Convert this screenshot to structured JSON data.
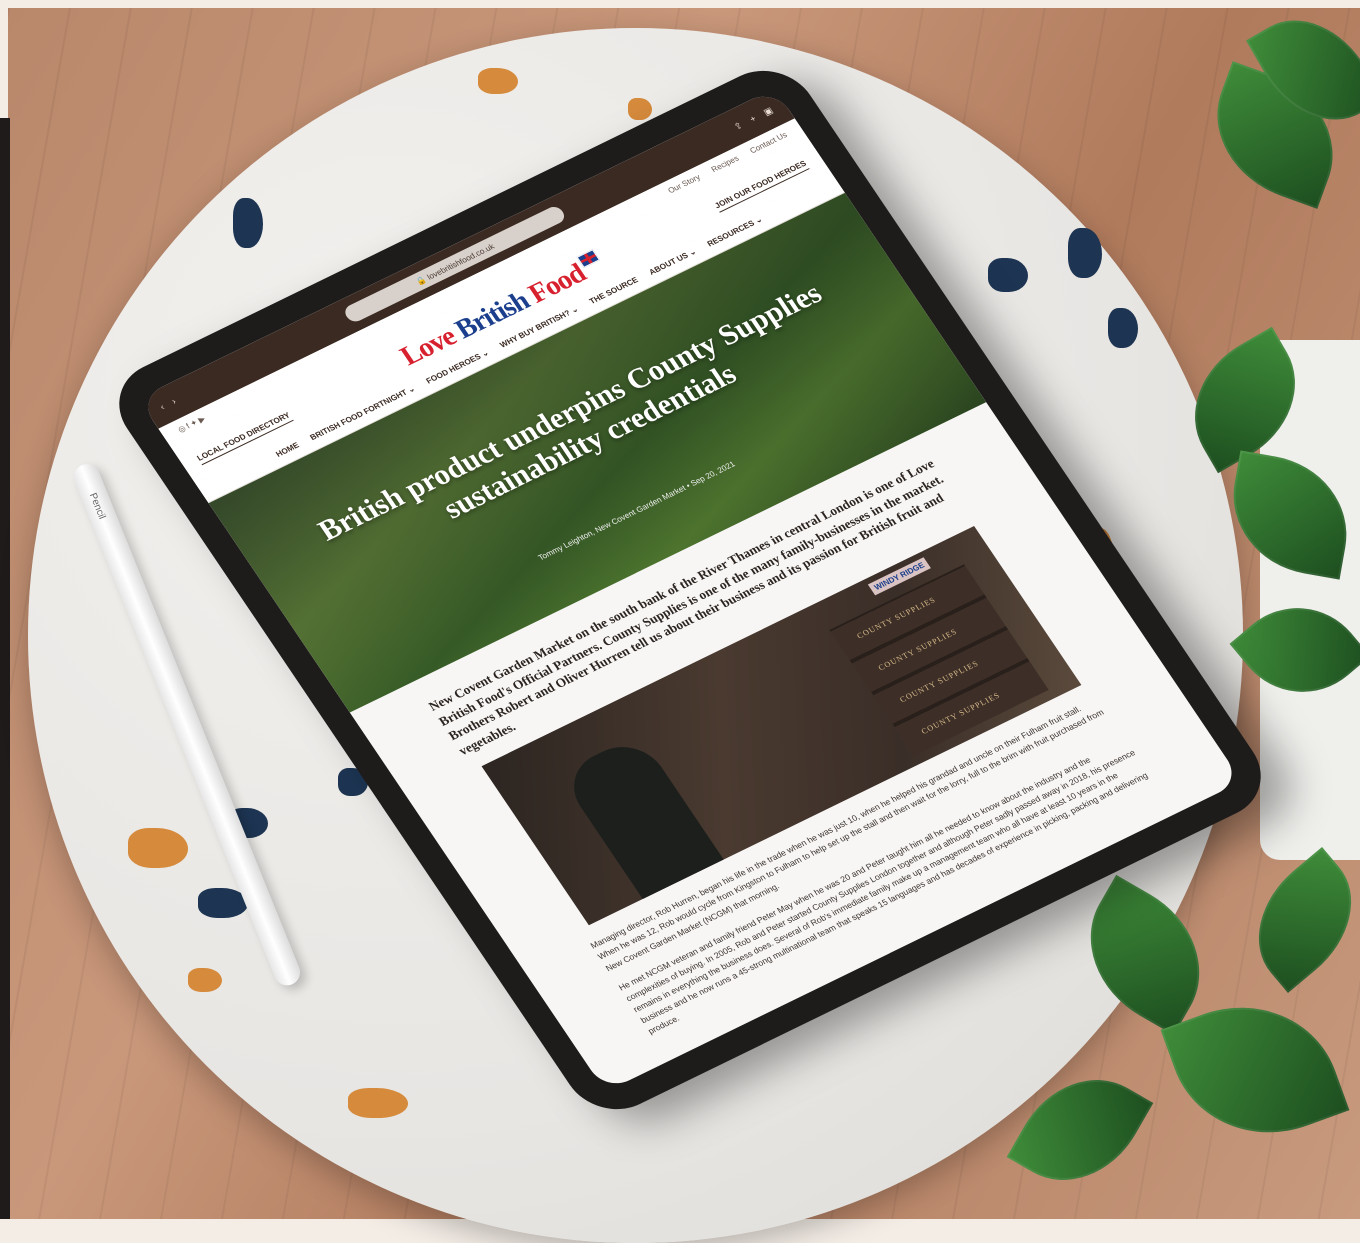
{
  "scene": {
    "pencil_label": "Pencil"
  },
  "browser": {
    "url": "lovebritishfood.co.uk"
  },
  "site": {
    "top_links": [
      "Our Story",
      "Recipes",
      "Contact Us"
    ],
    "directory_button": "LOCAL FOOD DIRECTORY",
    "join_button": "JOIN OUR FOOD HEROES",
    "logo_part1": "Love ",
    "logo_part2": "British",
    "logo_part3": " Food",
    "nav": [
      "HOME",
      "BRITISH FOOD FORTNIGHT ⌄",
      "FOOD HEROES ⌄",
      "WHY BUY BRITISH? ⌄",
      "THE SOURCE",
      "ABOUT US ⌄",
      "RESOURCES ⌄"
    ]
  },
  "article": {
    "title": "British product underpins County Supplies sustainability credentials",
    "meta": "Tommy Leighton, New Covent Garden Market • Sep 20, 2021",
    "lead": "New Covent Garden Market on the south bank of the River Thames in central London is one of Love British Food's Official Partners. County Supplies is one of the many family-businesses in the market. Brothers Robert and Oliver Hurren tell us about their business and its passion for British fruit and vegetables.",
    "photo_boxes_text": "COUNTY SUPPLIES",
    "photo_crate_text": "WINDY RIDGE",
    "paragraph1": "Managing director, Rob Hurren, began his life in the trade when he was just 10, when he helped his grandad and uncle on their Fulham fruit stall. When he was 12, Rob would cycle from Kingston to Fulham to help set up the stall and then wait for the lorry, full to the brim with fruit purchased from New Covent Garden Market (NCGM) that morning.",
    "paragraph2": "He met NCGM veteran and family friend Peter May when he was 20 and Peter taught him all he needed to know about the industry and the complexities of buying. In 2005, Rob and Peter started County Supplies London together and although Peter sadly passed away in 2018, his presence remains in everything the business does. Several of Rob's immediate family make up a management team who all have at least 10 years in the business and he now runs a 45-strong multinational team that speaks 15 languages and has decades of experience in picking, packing and delivering produce."
  }
}
